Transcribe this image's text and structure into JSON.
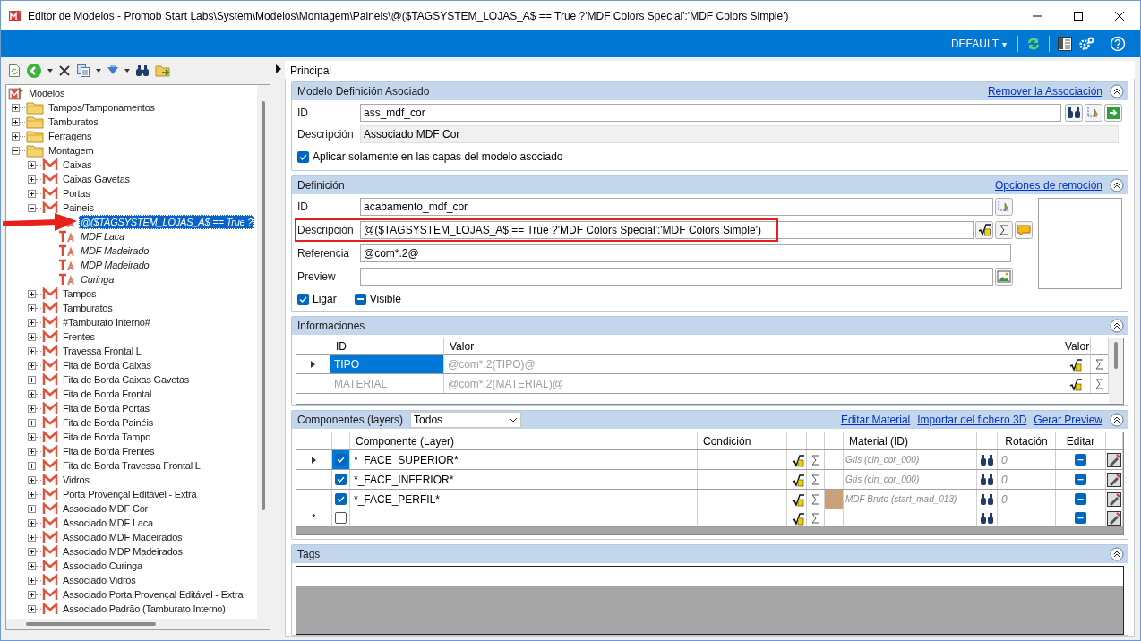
{
  "window": {
    "title": "Editor de Modelos - Promob Start Labs\\System\\Modelos\\Montagem\\Paineis\\@($TAGSYSTEM_LOJAS_A$ == True ?'MDF Colors Special':'MDF Colors Simple')"
  },
  "topbar": {
    "profile": "DEFAULT",
    "profile_caret": "▾"
  },
  "tree": {
    "label": "Modelos",
    "kind": "root",
    "selected": false,
    "children": [
      {
        "label": "Tampos/Tamponamentos",
        "kind": "folder",
        "expanded": false,
        "selected": false
      },
      {
        "label": "Tamburatos",
        "kind": "folder",
        "expanded": false,
        "selected": false
      },
      {
        "label": "Ferragens",
        "kind": "folder",
        "expanded": false,
        "selected": false
      },
      {
        "label": "Montagem",
        "kind": "folder",
        "expanded": true,
        "selected": false,
        "children": [
          {
            "label": "Caixas",
            "kind": "model",
            "expanded": false,
            "selected": false
          },
          {
            "label": "Caixas Gavetas",
            "kind": "model",
            "expanded": false,
            "selected": false
          },
          {
            "label": "Portas",
            "kind": "model",
            "expanded": false,
            "selected": false
          },
          {
            "label": "Paineis",
            "kind": "model",
            "expanded": true,
            "selected": false,
            "children": [
              {
                "label": "@($TAGSYSTEM_LOJAS_A$ == True ?",
                "kind": "definition",
                "selected": true
              },
              {
                "label": "MDF Laca",
                "kind": "definition",
                "selected": false
              },
              {
                "label": "MDF Madeirado",
                "kind": "definition",
                "selected": false
              },
              {
                "label": "MDP Madeirado",
                "kind": "definition",
                "selected": false
              },
              {
                "label": "Curinga",
                "kind": "definition",
                "selected": false
              }
            ]
          },
          {
            "label": "Tampos",
            "kind": "model",
            "expanded": false,
            "selected": false
          },
          {
            "label": "Tamburatos",
            "kind": "model",
            "expanded": false,
            "selected": false
          },
          {
            "label": "#Tamburato Interno#",
            "kind": "model",
            "expanded": false,
            "selected": false
          },
          {
            "label": "Frentes",
            "kind": "model",
            "expanded": false,
            "selected": false
          },
          {
            "label": "Travessa Frontal L",
            "kind": "model",
            "expanded": false,
            "selected": false
          },
          {
            "label": "Fita de Borda Caixas",
            "kind": "model",
            "expanded": false,
            "selected": false
          },
          {
            "label": "Fita de Borda Caixas Gavetas",
            "kind": "model",
            "expanded": false,
            "selected": false
          },
          {
            "label": "Fita de Borda Frontal",
            "kind": "model",
            "expanded": false,
            "selected": false
          },
          {
            "label": "Fita de Borda Portas",
            "kind": "model",
            "expanded": false,
            "selected": false
          },
          {
            "label": "Fita de Borda Painéis",
            "kind": "model",
            "expanded": false,
            "selected": false
          },
          {
            "label": "Fita de Borda Tampo",
            "kind": "model",
            "expanded": false,
            "selected": false
          },
          {
            "label": "Fita de Borda Frentes",
            "kind": "model",
            "expanded": false,
            "selected": false
          },
          {
            "label": "Fita de Borda Travessa Frontal L",
            "kind": "model",
            "expanded": false,
            "selected": false
          },
          {
            "label": "Vidros",
            "kind": "model",
            "expanded": false,
            "selected": false
          },
          {
            "label": "Porta Provençal Editável - Extra",
            "kind": "model",
            "expanded": false,
            "selected": false
          },
          {
            "label": "Associado MDF Cor",
            "kind": "model",
            "expanded": false,
            "selected": false
          },
          {
            "label": "Associado MDF Laca",
            "kind": "model",
            "expanded": false,
            "selected": false
          },
          {
            "label": "Associado MDF Madeirados",
            "kind": "model",
            "expanded": false,
            "selected": false
          },
          {
            "label": "Associado MDP Madeirados",
            "kind": "model",
            "expanded": false,
            "selected": false
          },
          {
            "label": "Associado Curinga",
            "kind": "model",
            "expanded": false,
            "selected": false
          },
          {
            "label": "Associado Vidros",
            "kind": "model",
            "expanded": false,
            "selected": false
          },
          {
            "label": "Associado Porta Provençal Editável - Extra",
            "kind": "model",
            "expanded": false,
            "selected": false
          },
          {
            "label": "Associado Padrão (Tamburato Interno)",
            "kind": "model",
            "expanded": false,
            "selected": false
          }
        ]
      }
    ]
  },
  "tab": {
    "label": "Principal"
  },
  "associated": {
    "title": "Modelo Definición Asociado",
    "link": "Remover la Associación",
    "fields": [
      {
        "label": "ID",
        "value": "ass_mdf_cor",
        "disabled": false
      },
      {
        "label": "Descripción",
        "value": "Associado MDF Cor",
        "disabled": true
      }
    ],
    "checkbox": {
      "label": "Aplicar solamente en las capas del modelo asociado",
      "checked": true
    }
  },
  "definition": {
    "title": "Definición",
    "link": "Opciones de remoción",
    "fields": [
      {
        "label": "ID",
        "value": "acabamento_mdf_cor",
        "highlighted": false
      },
      {
        "label": "Descripción",
        "value": "@($TAGSYSTEM_LOJAS_A$ == True ?'MDF Colors Special':'MDF Colors Simple')",
        "highlighted": true
      },
      {
        "label": "Referencia",
        "value": "@com*.2@",
        "highlighted": false
      },
      {
        "label": "Preview",
        "highlighted": false
      }
    ],
    "toggles": [
      {
        "label": "Ligar",
        "checked": true,
        "indeterminate": false
      },
      {
        "label": "Visible",
        "checked": false,
        "indeterminate": true
      }
    ]
  },
  "informaciones": {
    "title": "Informaciones",
    "columns": [
      "ID",
      "Valor",
      "Valor"
    ],
    "rows": [
      {
        "id": "TIPO",
        "value": "@com*.2(TIPO)@",
        "selected": true
      },
      {
        "id": "MATERIAL",
        "value": "@com*.2(MATERIAL)@",
        "selected": false
      }
    ]
  },
  "componentes": {
    "title": "Componentes (layers)",
    "filter": "Todos",
    "links": [
      "Editar Material",
      "Importar del fichero 3D",
      "Gerar Preview"
    ],
    "columns": [
      "Componente (Layer)",
      "Condición",
      "Material (ID)",
      "Rotación",
      "Editar"
    ],
    "rows": [
      {
        "checked": true,
        "selected": true,
        "layer": "*_FACE_SUPERIOR*",
        "material": "Gris (cin_cor_000)",
        "swatch": false,
        "rotation": "0"
      },
      {
        "checked": true,
        "selected": false,
        "layer": "*_FACE_INFERIOR*",
        "material": "Gris (cin_cor_000)",
        "swatch": false,
        "rotation": "0"
      },
      {
        "checked": true,
        "selected": false,
        "layer": "*_FACE_PERFIL*",
        "material": "MDF Bruto (start_mad_013)",
        "swatch": true,
        "rotation": "0"
      }
    ],
    "new_row": {
      "marker": "*",
      "checked": false
    }
  },
  "tags": {
    "title": "Tags"
  }
}
